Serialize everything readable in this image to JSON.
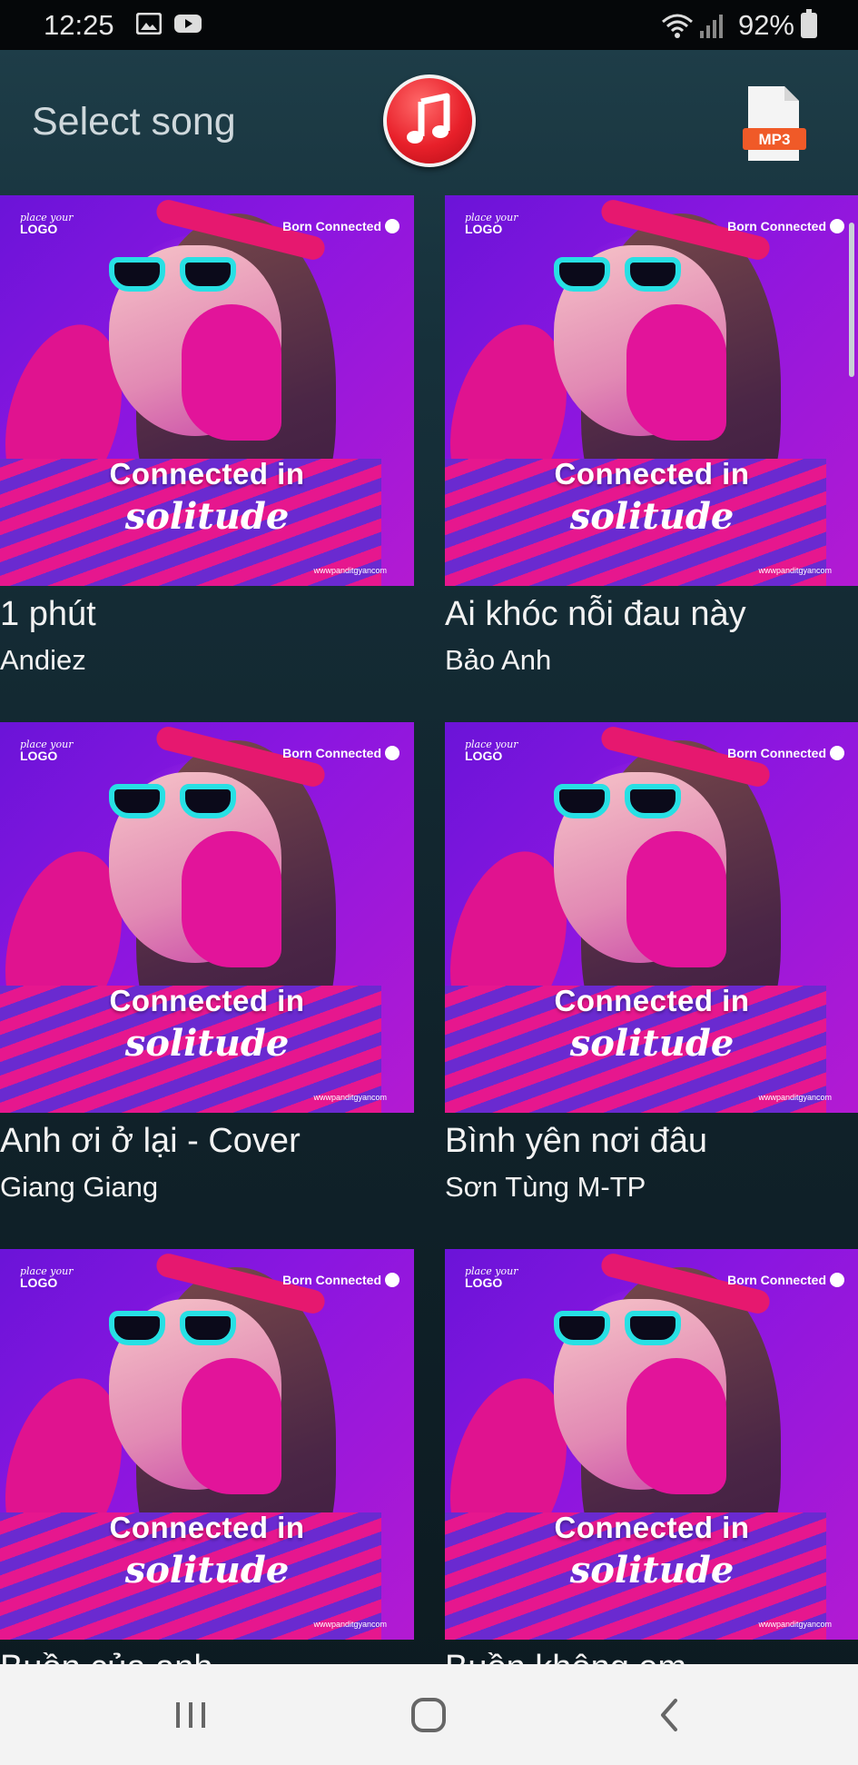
{
  "status_bar": {
    "time": "12:25",
    "battery_percent": "92%",
    "icons": [
      "image-icon",
      "youtube-icon",
      "wifi-icon",
      "signal-icon",
      "battery-icon"
    ]
  },
  "header": {
    "title": "Select song",
    "center_icon": "music-note-icon",
    "right_icon": "mp3-file-icon",
    "mp3_label": "MP3"
  },
  "cover_art": {
    "logo_small": "place your",
    "logo_big": "LOGO",
    "brand": "Born Connected",
    "headline": "Connected in",
    "subline": "solitude",
    "url": "wwwpanditgyancom"
  },
  "songs": [
    {
      "title": "1 phút",
      "artist": "Andiez"
    },
    {
      "title": "Ai khóc nỗi đau này",
      "artist": "Bảo Anh"
    },
    {
      "title": "Anh ơi ở lại - Cover",
      "artist": "Giang Giang"
    },
    {
      "title": "Bình yên nơi đâu",
      "artist": "Sơn Tùng M-TP"
    },
    {
      "title": "Buồn của anh",
      "artist": ""
    },
    {
      "title": "Buồn không em",
      "artist": ""
    }
  ],
  "nav": {
    "icons": [
      "recent-apps-icon",
      "home-icon",
      "back-icon"
    ]
  },
  "colors": {
    "accent_red": "#e8202a",
    "cover_purple": "#8a16e0",
    "cover_magenta": "#e6178e"
  }
}
